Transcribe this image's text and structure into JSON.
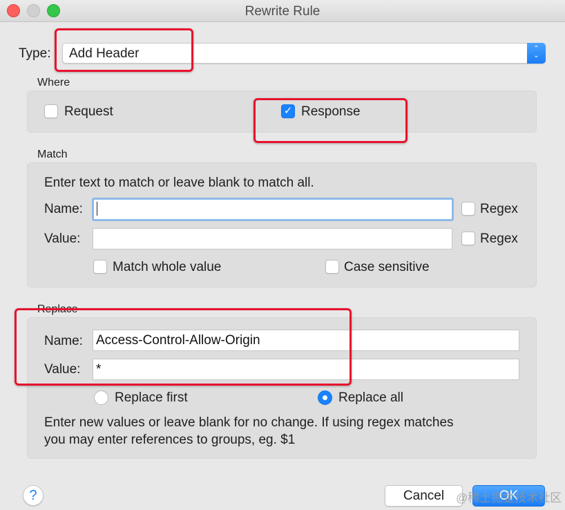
{
  "window": {
    "title": "Rewrite Rule"
  },
  "type": {
    "label": "Type:",
    "selected": "Add Header",
    "stepper_icon": "up-down-chevrons"
  },
  "where": {
    "section_label": "Where",
    "request": {
      "label": "Request",
      "checked": false
    },
    "response": {
      "label": "Response",
      "checked": true,
      "check_glyph": "✓"
    }
  },
  "match": {
    "section_label": "Match",
    "instructions": "Enter text to match or leave blank to match all.",
    "name_label": "Name:",
    "name_value": "",
    "name_regex_label": "Regex",
    "value_label": "Value:",
    "value_value": "",
    "value_regex_label": "Regex",
    "match_whole_value_label": "Match whole value",
    "case_sensitive_label": "Case sensitive"
  },
  "replace": {
    "section_label": "Replace",
    "name_label": "Name:",
    "name_value": "Access-Control-Allow-Origin",
    "value_label": "Value:",
    "value_value": "*",
    "replace_first_label": "Replace first",
    "replace_all_label": "Replace all",
    "selected_mode": "Replace all",
    "help_line1": "Enter new values or leave blank for no change. If using regex matches",
    "help_line2": "you may enter references to groups, eg. $1"
  },
  "footer": {
    "help_glyph": "?",
    "cancel_label": "Cancel",
    "ok_label": "OK"
  },
  "watermark": "@稀土掘金技术社区",
  "colors": {
    "accent": "#1a82fb",
    "annotation": "#e8112d",
    "focus_ring": "#8dbaea"
  }
}
